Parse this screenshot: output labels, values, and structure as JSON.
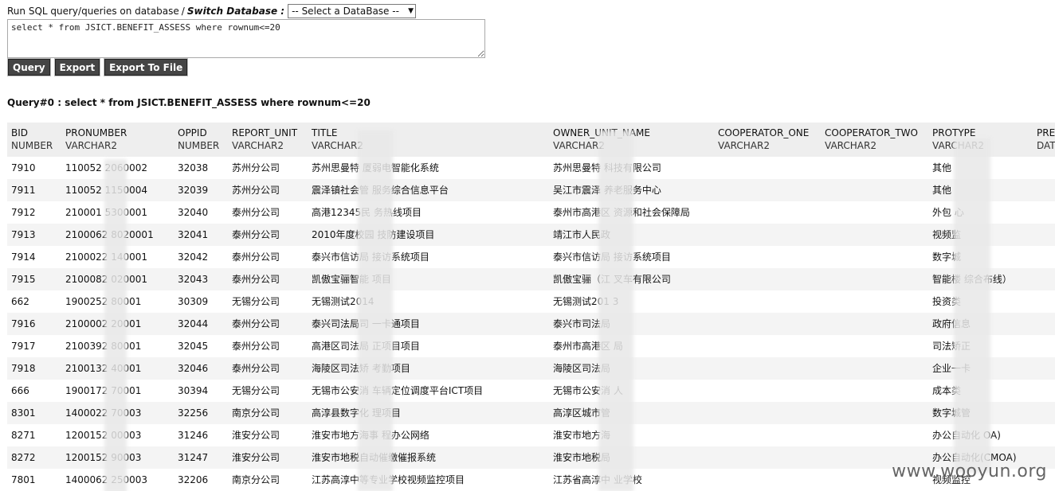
{
  "header": {
    "run_label": "Run SQL query/queries on database",
    "separator": "/",
    "switch_label": "Switch Database :",
    "db_select_value": "-- Select a DataBase --"
  },
  "query_input": "select * from JSICT.BENEFIT_ASSESS where rownum<=20",
  "buttons": {
    "query": "Query",
    "export": "Export",
    "export_to_file": "Export To File"
  },
  "result_title": "Query#0 : select * from JSICT.BENEFIT_ASSESS where rownum<=20",
  "columns": [
    {
      "name": "BID",
      "type": "NUMBER"
    },
    {
      "name": "PRONUMBER",
      "type": "VARCHAR2"
    },
    {
      "name": "OPPID",
      "type": "NUMBER"
    },
    {
      "name": "REPORT_UNIT",
      "type": "VARCHAR2"
    },
    {
      "name": "TITLE",
      "type": "VARCHAR2"
    },
    {
      "name": "OWNER_UNIT_NAME",
      "type": "VARCHAR2"
    },
    {
      "name": "COOPERATOR_ONE",
      "type": "VARCHAR2"
    },
    {
      "name": "COOPERATOR_TWO",
      "type": "VARCHAR2"
    },
    {
      "name": "PROTYPE",
      "type": "VARCHAR2"
    },
    {
      "name": "PRE",
      "type": "DAT"
    }
  ],
  "rows": [
    [
      "7910",
      "110052  2060002",
      "32038",
      "苏州分公司",
      "苏州思曼特    厦弱电智能化系统",
      "苏州思曼特    科技有限公司",
      "",
      "",
      "其他",
      ""
    ],
    [
      "7911",
      "110052   1150004",
      "32039",
      "苏州分公司",
      "震泽镇社会管    服务综合信息平台",
      "吴江市震泽    养老服务中心",
      "",
      "",
      "其他",
      ""
    ],
    [
      "7912",
      "210001    5300001",
      "32040",
      "泰州分公司",
      "高港12345民    务热线项目",
      "泰州市高港区    资源和社会保障局",
      "",
      "",
      "外包    心",
      ""
    ],
    [
      "7913",
      "2100062    8020001",
      "32041",
      "泰州分公司",
      "2010年度校园    技防建设项目",
      "靖江市人民政",
      "",
      "",
      "视频监",
      ""
    ],
    [
      "7914",
      "2100022     140001",
      "32042",
      "泰州分公司",
      "泰兴市信访局    接访系统项目",
      "泰兴市信访局    接访系统项目",
      "",
      "",
      "数字城",
      ""
    ],
    [
      "7915",
      "2100082     020001",
      "32043",
      "泰州分公司",
      "凯傲宝骊智能    项目",
      "凯傲宝骊（江    叉车有限公司",
      "",
      "",
      "智能楼    综合布线）",
      ""
    ],
    [
      "662",
      "1900252     80001",
      "30309",
      "无锡分公司",
      "无锡测试2014",
      "无锡测试201    3",
      "",
      "",
      "投资类",
      ""
    ],
    [
      "7916",
      "2100002     20001",
      "32044",
      "泰州分公司",
      "泰兴司法局司    一卡通项目",
      "泰兴市司法局",
      "",
      "",
      "政府信息",
      ""
    ],
    [
      "7917",
      "2100392     80001",
      "32045",
      "泰州分公司",
      "高港区司法局    正项目项目",
      "泰州市高港区    局",
      "",
      "",
      "司法矫正",
      ""
    ],
    [
      "7918",
      "2100132     40001",
      "32046",
      "泰州分公司",
      "海陵区司法矫    考勤项目",
      "海陵区司法局",
      "",
      "",
      "企业一卡",
      ""
    ],
    [
      "666",
      "1900172     70001",
      "30394",
      "无锡分公司",
      "无锡市公安消    车辆定位调度平台ICT项目",
      "无锡市公安消    人",
      "",
      "",
      "成本类",
      ""
    ],
    [
      "8301",
      "1400022     70003",
      "32256",
      "南京分公司",
      "高淳县数字化    理项目",
      "高淳区城市管",
      "",
      "",
      "数字城管",
      ""
    ],
    [
      "8271",
      "1200152     00003",
      "31246",
      "淮安分公司",
      "淮安市地方海事    程办公网络",
      "淮安市地方海",
      "",
      "",
      "办公自动化    OA)",
      ""
    ],
    [
      "8272",
      "1200152     90003",
      "31247",
      "淮安分公司",
      "淮安市地税自动催缴催报系统",
      "淮安市地税局",
      "",
      "",
      "办公自动化(CMOA)",
      ""
    ],
    [
      "7801",
      "1400062     250003",
      "32206",
      "南京分公司",
      "江苏高淳中等专业学校视频监控项目",
      "江苏省高淳中    业学校",
      "",
      "",
      "视频监控",
      ""
    ]
  ],
  "watermark": "www.wooyun.org"
}
